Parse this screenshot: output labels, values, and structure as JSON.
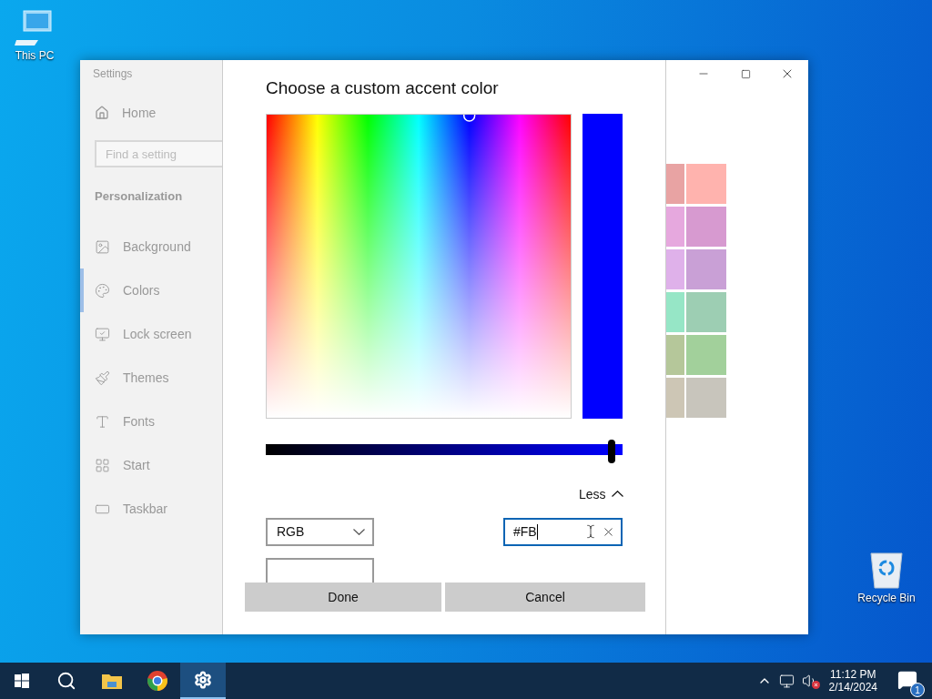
{
  "desktop_icons": [
    {
      "kind": "pc",
      "label": "This PC"
    },
    {
      "kind": "bin",
      "label": "Recycle Bin"
    }
  ],
  "settings_window": {
    "title": "Settings",
    "home": "Home",
    "search": {
      "placeholder": "Find a setting"
    },
    "section": "Personalization",
    "nav": [
      {
        "kind": "background",
        "label": "Background",
        "selected": false
      },
      {
        "kind": "colors",
        "label": "Colors",
        "selected": true
      },
      {
        "kind": "lock",
        "label": "Lock screen",
        "selected": false
      },
      {
        "kind": "themes",
        "label": "Themes",
        "selected": false
      },
      {
        "kind": "fonts",
        "label": "Fonts",
        "selected": false
      },
      {
        "kind": "start",
        "label": "Start",
        "selected": false
      },
      {
        "kind": "taskbar",
        "label": "Taskbar",
        "selected": false
      }
    ],
    "swatches": [
      {
        "color": "#e8a3a3"
      },
      {
        "color": "#ffb3ae"
      },
      {
        "color": "#e6a8de"
      },
      {
        "color": "#d79ad0"
      },
      {
        "color": "#dfb1ea"
      },
      {
        "color": "#c9a0d6"
      },
      {
        "color": "#96e6c6"
      },
      {
        "color": "#9dceb3"
      },
      {
        "color": "#b5c79a"
      },
      {
        "color": "#a2d09b"
      },
      {
        "color": "#cdc6b5"
      },
      {
        "color": "#c8c5bc"
      }
    ]
  },
  "dialog": {
    "title": "Choose a custom accent color",
    "preview": {
      "color": "#0000ff"
    },
    "brightness": {
      "level": 0.97
    },
    "toggle": {
      "label": "Less",
      "expanded": true
    },
    "mode_select": {
      "value": "RGB"
    },
    "hex_field": {
      "value": "#FB",
      "focused": true
    },
    "buttons": [
      "Done",
      "Cancel"
    ]
  },
  "taskbar": {
    "apps": [
      {
        "kind": "start",
        "active": false
      },
      {
        "kind": "search",
        "active": false
      },
      {
        "kind": "folder",
        "active": false
      },
      {
        "kind": "browser",
        "active": false
      },
      {
        "kind": "settings",
        "active": true
      }
    ],
    "tray": {
      "muted": true,
      "time": "11:12 PM",
      "date": "2/14/2024",
      "notifications": "1"
    }
  }
}
